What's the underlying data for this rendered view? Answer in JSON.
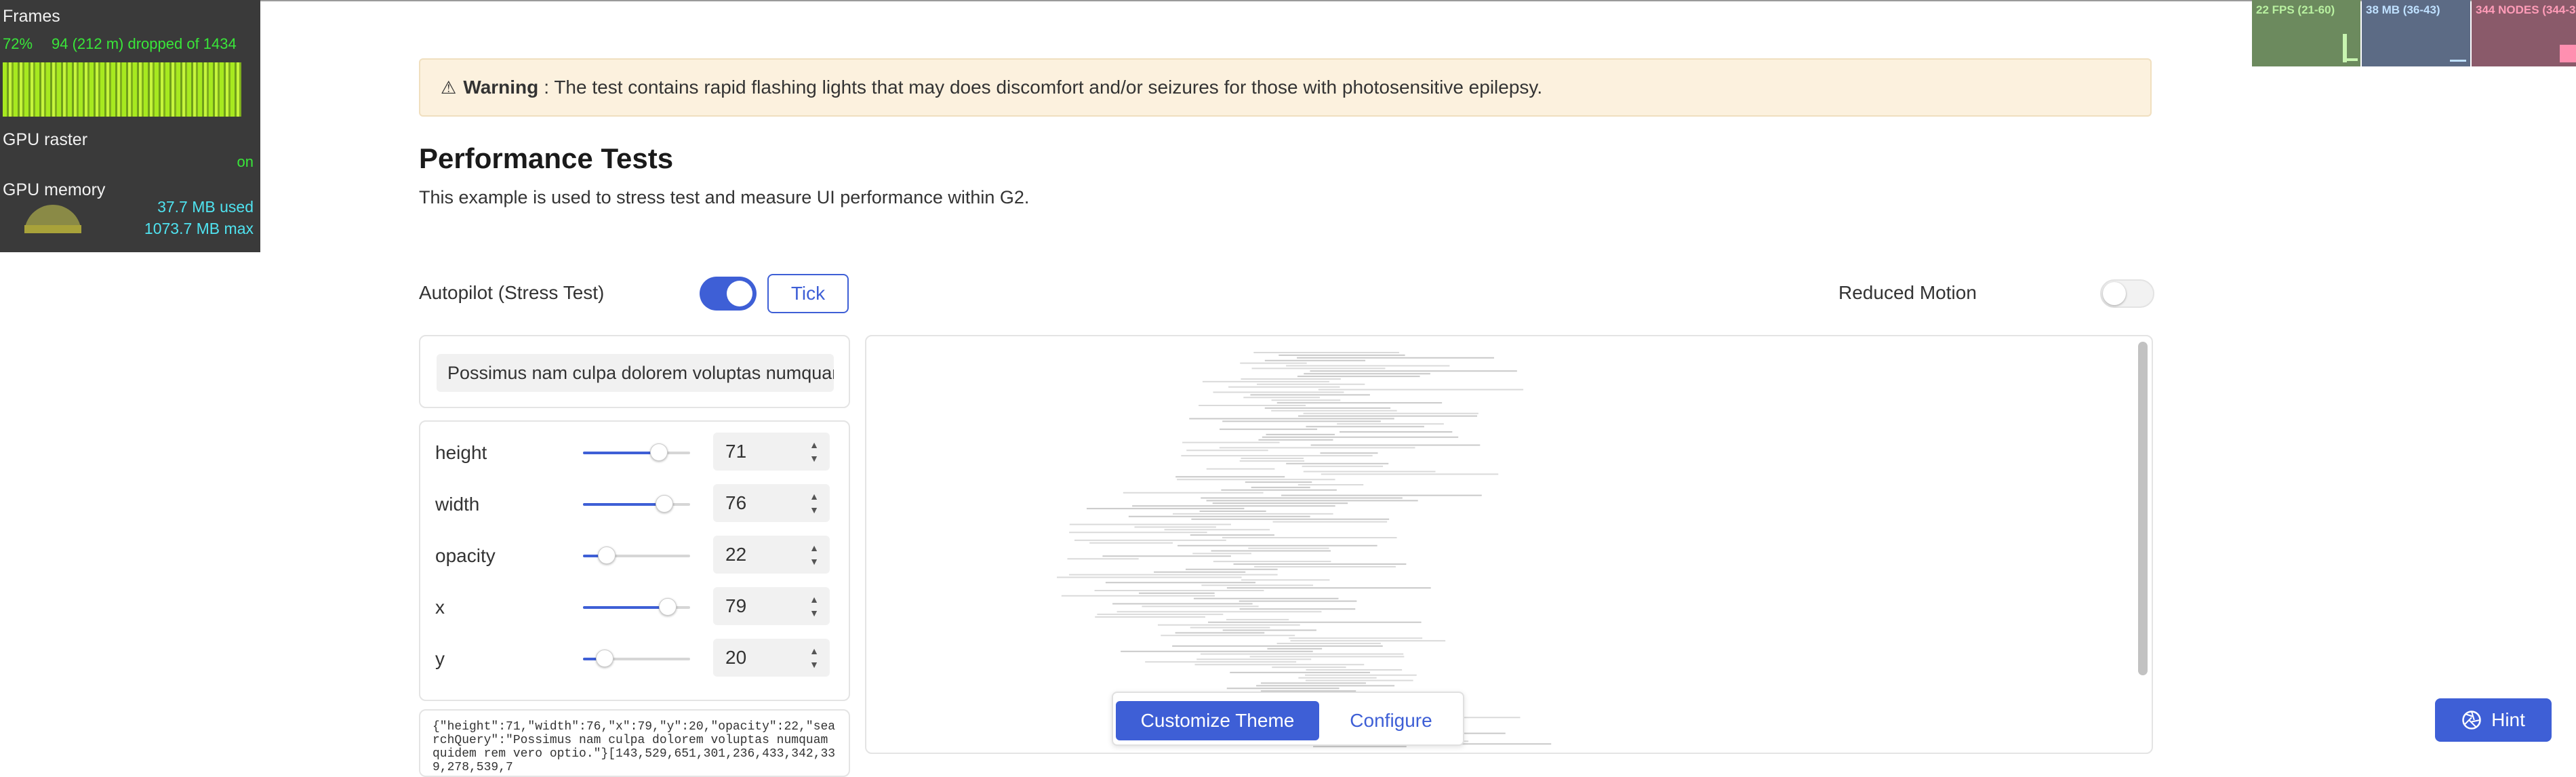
{
  "devtools": {
    "frames": {
      "title": "Frames",
      "percent": "72%",
      "dropped": "94 (212 m) dropped of 1434"
    },
    "gpu_raster": {
      "title": "GPU raster",
      "status": "on"
    },
    "gpu_memory": {
      "title": "GPU memory",
      "used": "37.7 MB used",
      "max": "1073.7 MB max"
    },
    "fps": "22 FPS (21-60)",
    "memory": "38 MB (36-43)",
    "nodes": "344 NODES (344-3"
  },
  "warning": {
    "icon": "warning-triangle-icon",
    "label": "Warning",
    "text": ": The test contains rapid flashing lights that may does discomfort and/or seizures for those with photosensitive epilepsy."
  },
  "page": {
    "title": "Performance Tests",
    "description": "This example is used to stress test and measure UI performance within G2."
  },
  "controls": {
    "autopilot_label": "Autopilot (Stress Test)",
    "autopilot_on": true,
    "tick_label": "Tick",
    "reduced_motion_label": "Reduced Motion",
    "reduced_motion_on": false
  },
  "search": {
    "value": "Possimus nam culpa dolorem voluptas numquam quidem rem vero optio."
  },
  "fields": [
    {
      "name": "height",
      "value": "71",
      "level": 0.71
    },
    {
      "name": "width",
      "value": "76",
      "level": 0.76
    },
    {
      "name": "opacity",
      "value": "22",
      "level": 0.22
    },
    {
      "name": "x",
      "value": "79",
      "level": 0.79
    },
    {
      "name": "y",
      "value": "20",
      "level": 0.2
    }
  ],
  "json_output": "{\"height\":71,\"width\":76,\"x\":79,\"y\":20,\"opacity\":22,\"searchQuery\":\"Possimus nam culpa dolorem voluptas numquam quidem rem vero optio.\"}[143,529,651,301,236,433,342,339,278,539,7",
  "bottom_bar": {
    "customize_label": "Customize Theme",
    "configure_label": "Configure"
  },
  "hint": {
    "label": "Hint",
    "icon": "aperture-icon"
  },
  "colors": {
    "accent": "#3e5fd6",
    "warning_bg": "#fcf1de"
  }
}
